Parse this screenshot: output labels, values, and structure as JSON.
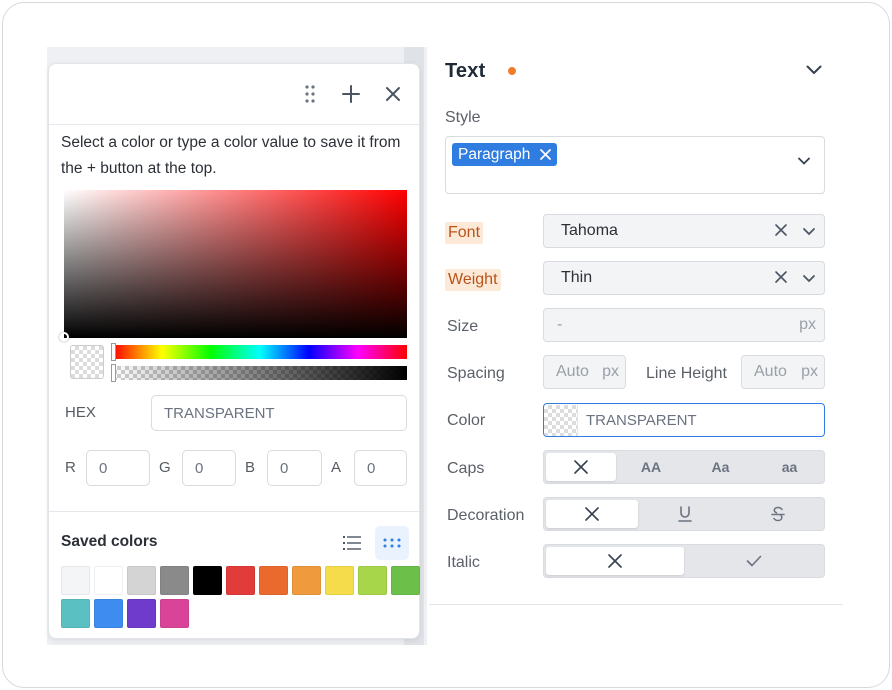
{
  "picker": {
    "hint": "Select a color or type a color value to save it from the + button at the top.",
    "hex_label": "HEX",
    "hex_value": "TRANSPARENT",
    "r_label": "R",
    "r_value": "0",
    "g_label": "G",
    "g_value": "0",
    "b_label": "B",
    "b_value": "0",
    "a_label": "A",
    "a_value": "0",
    "saved_title": "Saved colors",
    "saved_swatches": [
      "#f4f5f7",
      "#ffffff",
      "#d4d4d4",
      "#8a8a8a",
      "#000000",
      "#e23c3a",
      "#ea6a2e",
      "#ef9a3d",
      "#f4dc4a",
      "#a8d64a",
      "#6cc04a",
      "#5bc0c2",
      "#3f8cf0",
      "#6f3bcc",
      "#d94499"
    ],
    "icons": [
      "drag-handle-icon",
      "plus-icon",
      "close-icon",
      "list-view-icon",
      "grid-view-icon"
    ]
  },
  "panel": {
    "title": "Text",
    "accent_dot": "#f07c2c",
    "style_label": "Style",
    "style_chip": "Paragraph",
    "font_label": "Font",
    "font_value": "Tahoma",
    "weight_label": "Weight",
    "weight_value": "Thin",
    "size_label": "Size",
    "size_placeholder": "-",
    "size_unit": "px",
    "spacing_label": "Spacing",
    "spacing_placeholder": "Auto",
    "spacing_unit": "px",
    "line_height_label": "Line Height",
    "line_height_placeholder": "Auto",
    "line_height_unit": "px",
    "color_label": "Color",
    "color_value": "TRANSPARENT",
    "caps_label": "Caps",
    "caps_options": [
      "AA",
      "Aa",
      "aa"
    ],
    "decoration_label": "Decoration",
    "italic_label": "Italic"
  }
}
